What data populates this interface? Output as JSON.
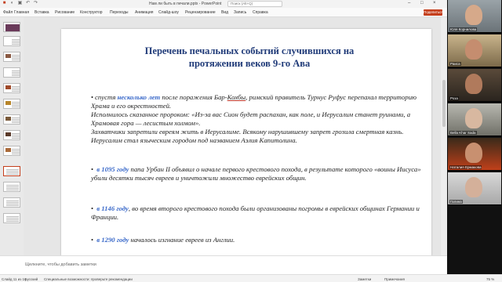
{
  "window": {
    "doc_title": "Нам ли быть в печали.pptx - PowerPoint",
    "search_placeholder": "Поиск (Alt+Q)",
    "share_label": "Поделиться"
  },
  "ribbon": {
    "tabs": [
      "Файл",
      "Главная",
      "Вставка",
      "Рисование",
      "Конструктор",
      "Переходы",
      "Анимация",
      "Слайд-шоу",
      "Рецензирование",
      "Вид",
      "Запись",
      "Справка"
    ]
  },
  "slide": {
    "title_line1": "Перечень печальных событий случившихся на",
    "title_line2": "протяжении веков 9-го Ава",
    "p1_a": "спустя ",
    "p1_hl": "несколько лет",
    "p1_b": " после поражения Бар-",
    "p1_ul": "Кохбы",
    "p1_c": ", римский правитель Турнус Руфус перепахал территорию Храма и его окрестностей.",
    "p1_d": "Исполнилось сказанное пророком: «Из-за вас Сион будет распахан, как поле, и Иерусалим станет руинами, а Храмовая гора — лесистым холмом».",
    "p1_e": "Захватчики запретили евреям жить в Иерусалиме. Всякому нарушившему запрет грозила смертная казнь. Иерусалим стал языческим городом под названием Аэлия Капитолина.",
    "p2_hl": "в 1095 году",
    "p2_text": " папа Урбан II объявил о начале первого крестового похода, в результате которого «воины Иисуса» убили десятки тысяч евреев и уничтожили множество еврейских общин.",
    "p3_hl": "в 1146 году",
    "p3_text": ", во время второго крестового похода были организованы погромы в еврейских общинах Германии и Франции.",
    "p4_hl": "в 1290 году",
    "p4_text": " началось изгнание евреев из Англии."
  },
  "notes": {
    "placeholder": "Щелкните, чтобы добавить заметки"
  },
  "status": {
    "slide_info": "Слайд 11 из 16",
    "language": "русский",
    "accessibility": "Специальные возможности: проверьте рекомендации",
    "notes_btn": "Заметки",
    "comments_btn": "Примечания",
    "zoom": "75 %"
  },
  "participants": [
    {
      "name": "Юля Корнилова"
    },
    {
      "name": "Раиса"
    },
    {
      "name": "Роза"
    },
    {
      "name": "Bella Khar Sada"
    },
    {
      "name": "Наталия Ермакова"
    },
    {
      "name": "Галина"
    }
  ],
  "colors": {
    "title": "#1f3a78",
    "highlight": "#3a69c9",
    "accent": "#c43e1c"
  }
}
